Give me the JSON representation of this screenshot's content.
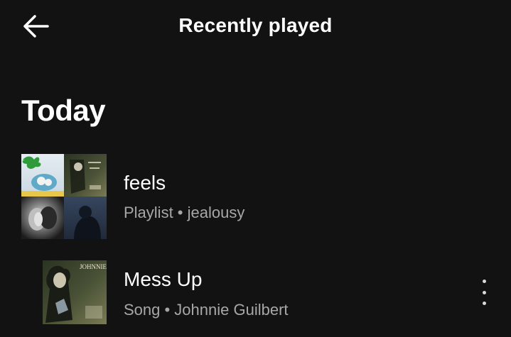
{
  "header": {
    "title": "Recently played",
    "back_icon": "arrow-left-icon"
  },
  "sections": [
    {
      "heading": "Today",
      "items": [
        {
          "title": "feels",
          "subtitle": "Playlist • jealousy",
          "artwork": "playlist-mosaic"
        },
        {
          "title": "Mess Up",
          "subtitle": "Song • Johnnie Guilbert",
          "artwork": "album-cover",
          "cover_text": "JOHNNIE GUILBERT",
          "more_icon": "more-vertical-icon"
        }
      ]
    }
  ],
  "colors": {
    "background": "#121212",
    "primary_text": "#ffffff",
    "secondary_text": "#a7a7a7"
  }
}
